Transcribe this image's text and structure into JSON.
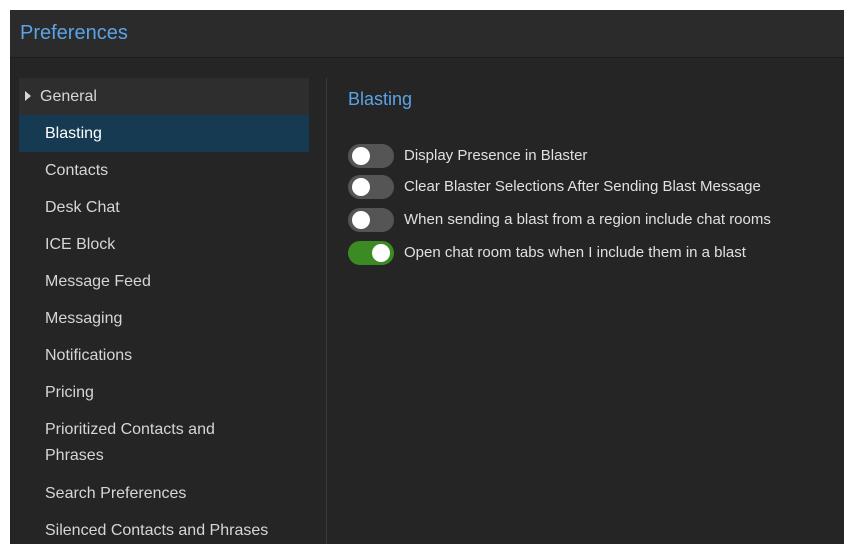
{
  "window": {
    "title": "Preferences"
  },
  "sidebar": {
    "items": [
      {
        "label": "General",
        "state": "collapsed-parent"
      },
      {
        "label": "Blasting",
        "state": "selected"
      },
      {
        "label": "Contacts"
      },
      {
        "label": "Desk Chat"
      },
      {
        "label": "ICE Block"
      },
      {
        "label": "Message Feed"
      },
      {
        "label": "Messaging"
      },
      {
        "label": "Notifications"
      },
      {
        "label": "Pricing"
      },
      {
        "label": "Prioritized Contacts and Phrases"
      },
      {
        "label": "Search Preferences"
      },
      {
        "label": "Silenced Contacts and Phrases"
      }
    ]
  },
  "main": {
    "section_title": "Blasting",
    "options": [
      {
        "label": "Display Presence in Blaster",
        "enabled": false
      },
      {
        "label": "Clear Blaster Selections After Sending Blast Message",
        "enabled": false
      },
      {
        "label": "When sending a blast from a region include chat rooms",
        "enabled": false
      },
      {
        "label": "Open chat room tabs when I include them in a blast",
        "enabled": true
      }
    ]
  },
  "colors": {
    "accent": "#5aa3e8",
    "selected_bg": "#163a52",
    "toggle_on": "#3c8b22",
    "toggle_off": "#555555",
    "background": "#252525"
  }
}
